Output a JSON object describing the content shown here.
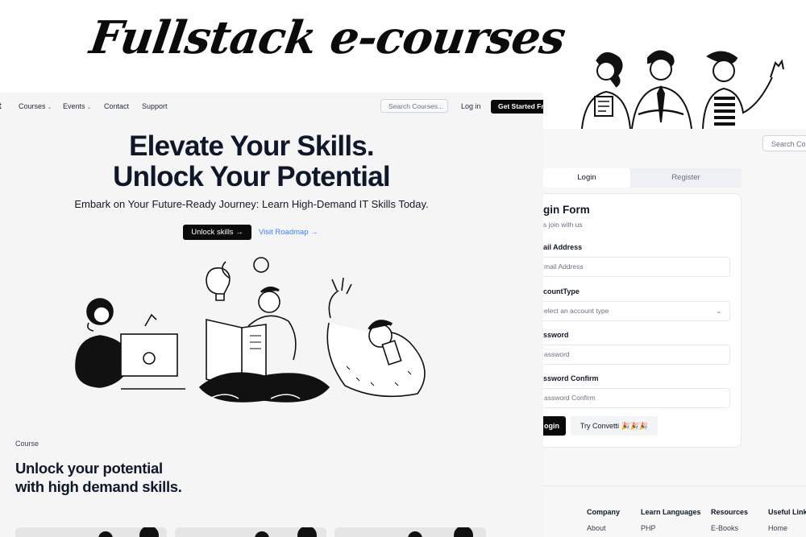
{
  "banner": {
    "title": "Fullstack e-courses"
  },
  "left": {
    "nav": {
      "brand": "t",
      "items": [
        {
          "label": "Courses",
          "has_caret": true
        },
        {
          "label": "Events",
          "has_caret": true
        },
        {
          "label": "Contact",
          "has_caret": false
        },
        {
          "label": "Support",
          "has_caret": false
        }
      ],
      "search_placeholder": "Search Courses...",
      "login": "Log in",
      "cta": "Get Started Fr"
    },
    "hero": {
      "title_line1": "Elevate Your Skills.",
      "title_line2": "Unlock Your Potential",
      "subtitle": "Embark on Your Future-Ready Journey: Learn High-Demand IT Skills Today.",
      "primary_button": "Unlock skills →",
      "secondary_link": "Visit Roadmap →"
    },
    "course_section": {
      "label": "Course",
      "title_line1": "Unlock your potential",
      "title_line2": "with high demand skills."
    }
  },
  "right": {
    "search_placeholder": "Search Co",
    "tabs": [
      {
        "label": "Login",
        "active": true
      },
      {
        "label": "Register",
        "active": false
      }
    ],
    "form": {
      "title": "gin Form",
      "subtitle": "s join with us",
      "fields": [
        {
          "label": "ail Address",
          "placeholder": "mail Address"
        },
        {
          "label": "countType",
          "placeholder": "elect an account type"
        },
        {
          "label": "ssword",
          "placeholder": "assword"
        },
        {
          "label": "ssword Confirm",
          "placeholder": "assword Confirm"
        }
      ],
      "submit": "ogin",
      "secondary": "Try Convetti 🎉🎉🎉"
    },
    "footer": {
      "columns": [
        {
          "title": "Company",
          "link": "About"
        },
        {
          "title": "Learn Languages",
          "link": "PHP"
        },
        {
          "title": "Resources",
          "link": "E-Books"
        },
        {
          "title": "Useful Link",
          "link": "Home"
        }
      ]
    }
  },
  "colors": {
    "accent_link": "#3b82f6",
    "button_dark": "#0a0a0a",
    "page_bg": "#f5f5f5"
  }
}
